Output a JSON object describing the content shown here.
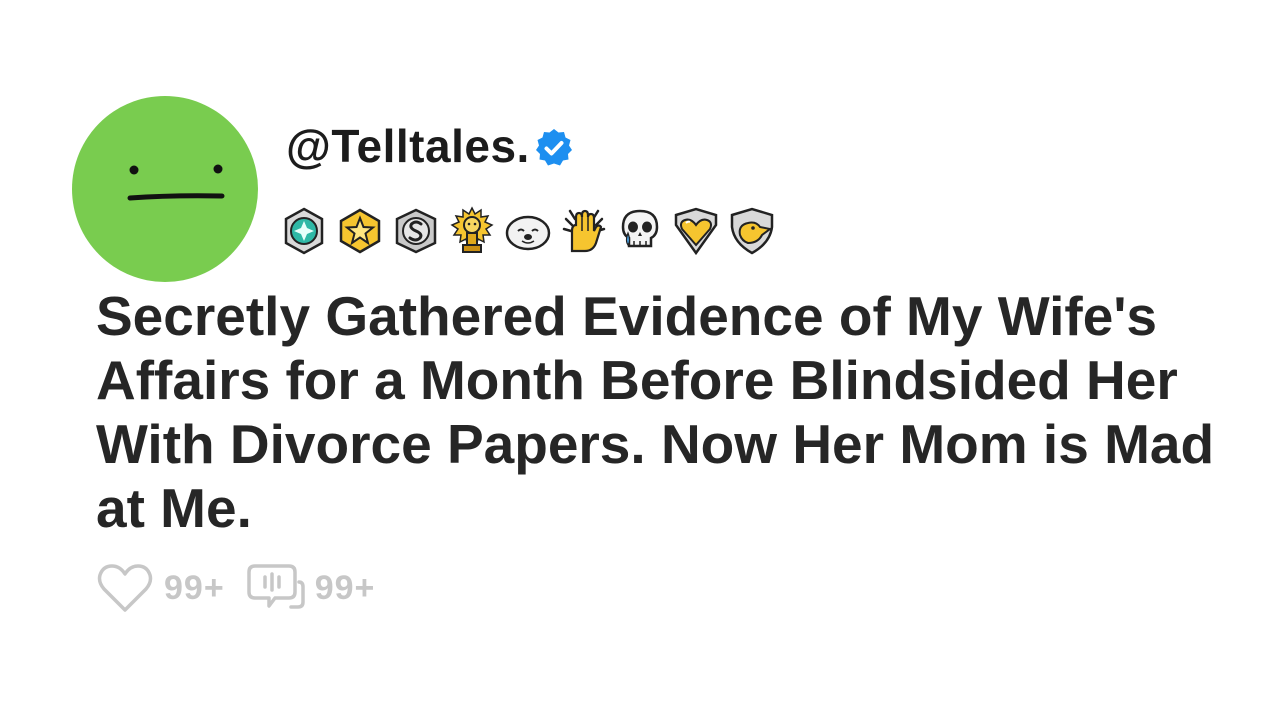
{
  "post": {
    "username": "@Telltales.",
    "verified_color": "#1d8ff0",
    "avatar_color": "#79cc4f",
    "awards": [
      "diamond-gem-award-icon",
      "gold-star-award-icon",
      "silver-s-award-icon",
      "golden-trophy-award-icon",
      "seal-emoji-award-icon",
      "high-five-hands-award-icon",
      "crying-skull-award-icon",
      "gold-heart-badge-award-icon",
      "duck-shield-award-icon"
    ],
    "title": "Secretly Gathered Evidence of My Wife's Affairs for a Month Before Blindsided Her With Divorce Papers. Now Her Mom is Mad at Me.",
    "likes": "99+",
    "comments": "99+"
  }
}
